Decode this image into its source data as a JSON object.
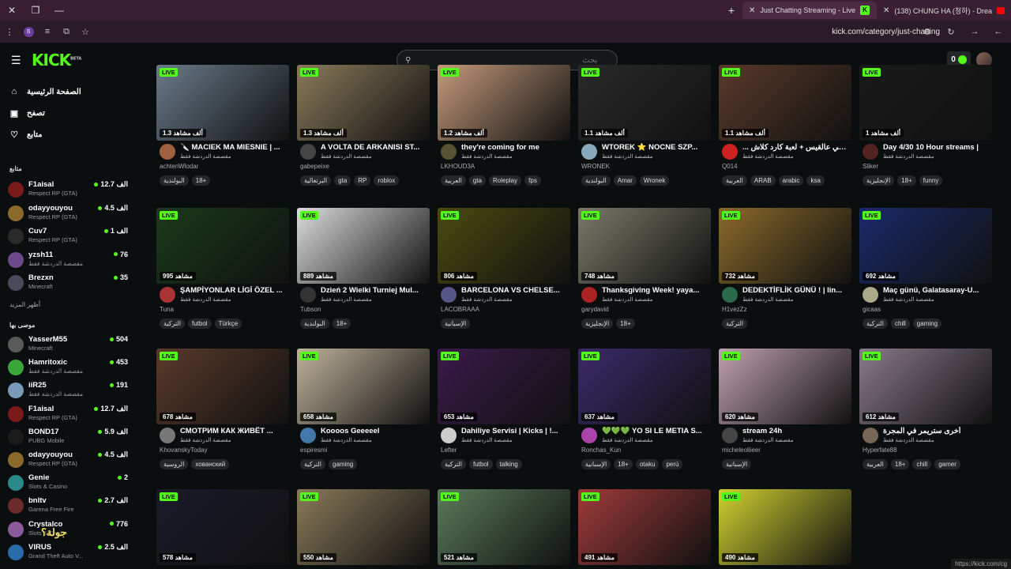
{
  "browser": {
    "tabs": [
      {
        "title": "Just Chatting Streaming - Live",
        "active": true,
        "favicon": "kick-icon"
      },
      {
        "title": "(138) CHUNG HA (청하) - Drea",
        "active": false,
        "favicon": "youtube-icon"
      }
    ],
    "url": "kick.com/category/just-chatting",
    "profile_initial": "S",
    "status_url": "https://kick.com/cg"
  },
  "header": {
    "logo": "KICK",
    "logo_badge": "BETA",
    "search_placeholder": "بحث",
    "wallet_amount": "0"
  },
  "sidebar": {
    "nav": [
      {
        "label": "الصفحة الرئيسية",
        "icon": "home-icon"
      },
      {
        "label": "تصفح",
        "icon": "browse-icon"
      },
      {
        "label": "متابع",
        "icon": "heart-icon"
      }
    ],
    "following_title": "متابع",
    "following": [
      {
        "name": "F1aisal",
        "game": "Respect RP (GTA)",
        "count": "12.7 الف",
        "color": "#7a1a1a"
      },
      {
        "name": "odayyouyou",
        "game": "Respect RP (GTA)",
        "count": "4.5 الف",
        "color": "#8a6a2a"
      },
      {
        "name": "Cuv7",
        "game": "Respect RP (GTA)",
        "count": "1 الف",
        "color": "#2a2a2a"
      },
      {
        "name": "yzsh11",
        "game": "مقصصة الدردشة فقط",
        "count": "76",
        "color": "#6a4a8a"
      },
      {
        "name": "Brezxn",
        "game": "Minecraft",
        "count": "35",
        "color": "#4a4a5a"
      }
    ],
    "show_more": "أظهر المزيد",
    "recommended_title": "موصى بها",
    "recommended": [
      {
        "name": "YasserM55",
        "game": "Minecraft",
        "count": "504",
        "color": "#5a5a5a"
      },
      {
        "name": "Hamritoxic",
        "game": "مقصصة الدردشة فقط",
        "count": "453",
        "color": "#3aa63a"
      },
      {
        "name": "iiR25",
        "game": "مقصصة الدردشة فقط",
        "count": "191",
        "color": "#7a9aba"
      },
      {
        "name": "F1aisal",
        "game": "Respect RP (GTA)",
        "count": "12.7 الف",
        "color": "#7a1a1a"
      },
      {
        "name": "BOND17",
        "game": "PUBG Mobile",
        "count": "5.9 الف",
        "color": "#1a1a1a"
      },
      {
        "name": "odayyouyou",
        "game": "Respect RP (GTA)",
        "count": "4.5 الف",
        "color": "#8a6a2a"
      },
      {
        "name": "Genie",
        "game": "Slots & Casino",
        "count": "2",
        "color": "#2a8a8a"
      },
      {
        "name": "bnltv",
        "game": "Garena Free Fire",
        "count": "2.7 الف",
        "color": "#6a2a2a"
      },
      {
        "name": "Crystalco",
        "game": "Slots & Casino",
        "count": "776",
        "color": "#8a5a9a"
      },
      {
        "name": "VIRUS",
        "game": "Grand Theft Auto V...",
        "count": "2.5 الف",
        "color": "#2a6aaa"
      }
    ]
  },
  "category_label": "مقصصة الدردشة فقط",
  "streams": [
    {
      "title": "🔪 MACIEK MA MIESNIE | ...",
      "streamer": "achtenWlodar",
      "viewers": "1.3 ألف مشاهد",
      "tags": [
        "البولندية",
        "18+"
      ],
      "thumb": "#6a7a8a",
      "av": "#a06040"
    },
    {
      "title": "A VOLTA DE ARKANISI ST...",
      "streamer": "gabepeixe",
      "viewers": "1.3 ألف مشاهد",
      "tags": [
        "البرتغالية",
        "gta",
        "RP",
        "roblox"
      ],
      "thumb": "#8a7a5a",
      "av": "#444"
    },
    {
      "title": "they're coming for me",
      "streamer": "LKHOUD3A",
      "viewers": "1.2 ألف مشاهد",
      "tags": [
        "العربية",
        "gta",
        "Roleplay",
        "fps"
      ],
      "thumb": "#c49a7a",
      "av": "#553"
    },
    {
      "title": "WTOREK ⭐ NOCNE SZP...",
      "streamer": "WRONEK",
      "viewers": "1.1 ألف مشاهد",
      "tags": [
        "البولندية",
        "Amar",
        "Wronek"
      ],
      "thumb": "#2a2a2a",
      "av": "#8ab"
    },
    {
      "title": "... و تتشي عالقيس + لعبة كارد كلاش",
      "streamer": "Q014",
      "viewers": "1.1 ألف مشاهد",
      "tags": [
        "العربية",
        "ARAB",
        "arabic",
        "ksa"
      ],
      "thumb": "#5a3a2a",
      "av": "#c22"
    },
    {
      "title": "Day 4/30 10 Hour streams |",
      "streamer": "Sliker",
      "viewers": "1 ألف مشاهد",
      "tags": [
        "الإنجليزية",
        "18+",
        "funny"
      ],
      "thumb": "#1a1a1a",
      "av": "#522"
    },
    {
      "title": "ŞAMPİYONLAR LİGİ ÖZEL ...",
      "streamer": "Tuna",
      "viewers": "995 مشاهد",
      "tags": [
        "التركية",
        "futbol",
        "Türkçe"
      ],
      "thumb": "#1a3a1a",
      "av": "#a33"
    },
    {
      "title": "Dzień 2 Wielki Turniej Mul...",
      "streamer": "Tubson",
      "viewers": "889 مشاهد",
      "tags": [
        "البولندية",
        "18+"
      ],
      "thumb": "#dcdcdc",
      "av": "#333"
    },
    {
      "title": "BARCELONA VS CHELSE...",
      "streamer": "LACOBRAAA",
      "viewers": "806 مشاهد",
      "tags": [
        "الإسبانية"
      ],
      "thumb": "#4a4a10",
      "av": "#558"
    },
    {
      "title": "Thanksgiving Week! yaya...",
      "streamer": "garydavid",
      "viewers": "748 مشاهد",
      "tags": [
        "الإنجليزية",
        "18+"
      ],
      "thumb": "#7a7a6a",
      "av": "#a22"
    },
    {
      "title": "DEDEKTİFLİK GÜNÜ ! | lin...",
      "streamer": "H1vezZz",
      "viewers": "732 مشاهد",
      "tags": [
        "التركية"
      ],
      "thumb": "#8a6a2a",
      "av": "#2a6a4a"
    },
    {
      "title": "Maç günü, Galatasaray-U...",
      "streamer": "gicaas",
      "viewers": "692 مشاهد",
      "tags": [
        "التركية",
        "chill",
        "gaming"
      ],
      "thumb": "#1a2a6a",
      "av": "#aa8"
    },
    {
      "title": "СМОТРИМ КАК ЖИВЁТ ...",
      "streamer": "KhovanskyToday",
      "viewers": "678 مشاهد",
      "tags": [
        "الروسية",
        "хованский"
      ],
      "thumb": "#5a3a2a",
      "av": "#777"
    },
    {
      "title": "Koooos Geeeeel",
      "streamer": "espiresmi",
      "viewers": "658 مشاهد",
      "tags": [
        "التركية",
        "gaming"
      ],
      "thumb": "#bfb29a",
      "av": "#47a"
    },
    {
      "title": "Dahiliye Servisi | Kicks | !...",
      "streamer": "Lefter",
      "viewers": "653 مشاهد",
      "tags": [
        "التركية",
        "futbol",
        "talking"
      ],
      "thumb": "#3a1a4a",
      "av": "#ccc"
    },
    {
      "title": "💚💚💚 YO SI LE METIA S...",
      "streamer": "Ronchas_Kun",
      "viewers": "637 مشاهد",
      "tags": [
        "الإسبانية",
        "18+",
        "otaku",
        "perú"
      ],
      "thumb": "#3a2a6a",
      "av": "#a4a"
    },
    {
      "title": "stream 24h",
      "streamer": "micheleoliieer",
      "viewers": "620 مشاهد",
      "tags": [
        "الإسبانية"
      ],
      "thumb": "#c0a0b0",
      "av": "#444"
    },
    {
      "title": "أخرى ستريمر في المجرة",
      "streamer": "Hyperfate88",
      "viewers": "612 مشاهد",
      "tags": [
        "العربية",
        "18+",
        "chill",
        "gamer"
      ],
      "thumb": "#8a7a8a",
      "av": "#765"
    },
    {
      "title": "",
      "streamer": "",
      "viewers": "578 مشاهد",
      "tags": [],
      "thumb": "#1a1a2a",
      "av": "#333"
    },
    {
      "title": "",
      "streamer": "",
      "viewers": "550 مشاهد",
      "tags": [],
      "thumb": "#8a7a5a",
      "av": "#333"
    },
    {
      "title": "",
      "streamer": "",
      "viewers": "521 مشاهد",
      "tags": [],
      "thumb": "#5a7a5a",
      "av": "#333"
    },
    {
      "title": "",
      "streamer": "",
      "viewers": "491 مشاهد",
      "tags": [],
      "thumb": "#a03a3a",
      "av": "#333"
    },
    {
      "title": "",
      "streamer": "",
      "viewers": "490 مشاهد",
      "tags": [],
      "thumb": "#d0d030",
      "av": "#333"
    }
  ],
  "live_label": "LIVE",
  "overlay_text": "جولة؟"
}
